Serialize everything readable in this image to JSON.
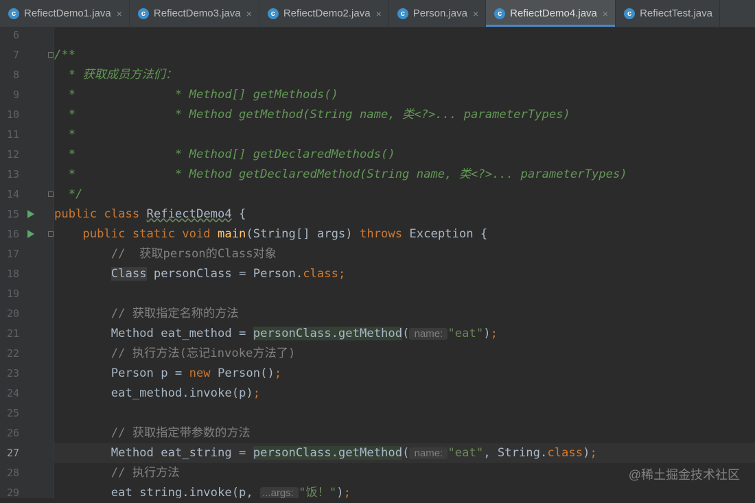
{
  "tabs": [
    {
      "label": "RefiectDemo1.java",
      "icon": "class-icon",
      "icon_glyph": "c",
      "closable": true,
      "active": false
    },
    {
      "label": "RefiectDemo3.java",
      "icon": "class-icon",
      "icon_glyph": "c",
      "closable": true,
      "active": false
    },
    {
      "label": "RefiectDemo2.java",
      "icon": "class-icon",
      "icon_glyph": "c",
      "closable": true,
      "active": false
    },
    {
      "label": "Person.java",
      "icon": "class-icon",
      "icon_glyph": "c",
      "closable": true,
      "active": false
    },
    {
      "label": "RefiectDemo4.java",
      "icon": "class-icon",
      "icon_glyph": "c",
      "closable": true,
      "active": true
    },
    {
      "label": "RefiectTest.java",
      "icon": "class-icon",
      "icon_glyph": "c",
      "closable": false,
      "active": false
    }
  ],
  "close_glyph": "×",
  "current_line": 27,
  "colors": {
    "keyword": "#cc7832",
    "comment": "#808080",
    "doc": "#629755",
    "string": "#6a8759",
    "method": "#ffc66d",
    "text": "#a9b7c6",
    "background": "#2b2b2b",
    "gutter": "#313335"
  },
  "lines": [
    {
      "n": "6",
      "tokens": []
    },
    {
      "n": "7",
      "fold": true,
      "tokens": [
        {
          "t": "/**",
          "c": "doc"
        }
      ]
    },
    {
      "n": "8",
      "tokens": [
        {
          "t": "  * 获取成员方法们：",
          "c": "doc"
        }
      ]
    },
    {
      "n": "9",
      "tokens": [
        {
          "t": "  *              * Method[] getMethods()",
          "c": "doc"
        }
      ]
    },
    {
      "n": "10",
      "tokens": [
        {
          "t": "  *              * Method getMethod(String name, ",
          "c": "doc"
        },
        {
          "t": "类",
          "c": "doc"
        },
        {
          "t": "<?>... parameterTypes)",
          "c": "doc"
        }
      ]
    },
    {
      "n": "11",
      "tokens": [
        {
          "t": "  *",
          "c": "doc"
        }
      ]
    },
    {
      "n": "12",
      "tokens": [
        {
          "t": "  *              * Method[] getDeclaredMethods()",
          "c": "doc"
        }
      ]
    },
    {
      "n": "13",
      "tokens": [
        {
          "t": "  *              * Method getDeclaredMethod(String name, ",
          "c": "doc"
        },
        {
          "t": "类",
          "c": "doc"
        },
        {
          "t": "<?>... parameterTypes)",
          "c": "doc"
        }
      ]
    },
    {
      "n": "14",
      "fold": true,
      "tokens": [
        {
          "t": "  */",
          "c": "doc"
        }
      ]
    },
    {
      "n": "15",
      "run": true,
      "tokens": [
        {
          "t": "public class ",
          "c": "kw"
        },
        {
          "t": "RefiectDemo4",
          "c": "cls-under"
        },
        {
          "t": " {",
          "c": ""
        }
      ]
    },
    {
      "n": "16",
      "run": true,
      "fold": true,
      "tokens": [
        {
          "t": "    public static void ",
          "c": "kw"
        },
        {
          "t": "main",
          "c": "fn"
        },
        {
          "t": "(String[] args) ",
          "c": ""
        },
        {
          "t": "throws ",
          "c": "kw"
        },
        {
          "t": "Exception {",
          "c": ""
        }
      ]
    },
    {
      "n": "17",
      "tokens": [
        {
          "t": "        //  获取person的Class对象",
          "c": "cm"
        }
      ]
    },
    {
      "n": "18",
      "tokens": [
        {
          "t": "        ",
          "c": ""
        },
        {
          "t": "Class",
          "c": "hl2"
        },
        {
          "t": " personClass = Person.",
          "c": ""
        },
        {
          "t": "class",
          "c": "kw"
        },
        {
          "t": ";",
          "c": "kw"
        }
      ]
    },
    {
      "n": "19",
      "tokens": []
    },
    {
      "n": "20",
      "tokens": [
        {
          "t": "        // 获取指定名称的方法",
          "c": "cm"
        }
      ]
    },
    {
      "n": "21",
      "tokens": [
        {
          "t": "        Method eat_method = ",
          "c": ""
        },
        {
          "t": "personClass.getMethod",
          "c": "hl"
        },
        {
          "t": "(",
          "c": ""
        },
        {
          "t": " name: ",
          "c": "hint"
        },
        {
          "t": "\"eat\"",
          "c": "str"
        },
        {
          "t": ")",
          "c": ""
        },
        {
          "t": ";",
          "c": "kw"
        }
      ]
    },
    {
      "n": "22",
      "tokens": [
        {
          "t": "        // 执行方法(忘记invoke方法了)",
          "c": "cm"
        }
      ]
    },
    {
      "n": "23",
      "tokens": [
        {
          "t": "        Person p = ",
          "c": ""
        },
        {
          "t": "new ",
          "c": "kw"
        },
        {
          "t": "Person()",
          "c": ""
        },
        {
          "t": ";",
          "c": "kw"
        }
      ]
    },
    {
      "n": "24",
      "tokens": [
        {
          "t": "        eat_method.invoke(p)",
          "c": ""
        },
        {
          "t": ";",
          "c": "kw"
        }
      ]
    },
    {
      "n": "25",
      "tokens": []
    },
    {
      "n": "26",
      "tokens": [
        {
          "t": "        // 获取指定带参数的方法",
          "c": "cm"
        }
      ]
    },
    {
      "n": "27",
      "tokens": [
        {
          "t": "        Method eat_string = ",
          "c": ""
        },
        {
          "t": "personClass.getMethod",
          "c": "hl"
        },
        {
          "t": "(",
          "c": ""
        },
        {
          "t": " name: ",
          "c": "hint"
        },
        {
          "t": "\"eat\"",
          "c": "str"
        },
        {
          "t": ", String.",
          "c": ""
        },
        {
          "t": "class",
          "c": "kw"
        },
        {
          "t": ")",
          "c": ""
        },
        {
          "t": ";",
          "c": "kw"
        }
      ]
    },
    {
      "n": "28",
      "tokens": [
        {
          "t": "        // 执行方法",
          "c": "cm"
        }
      ]
    },
    {
      "n": "29",
      "tokens": [
        {
          "t": "        eat_string.invoke(p, ",
          "c": ""
        },
        {
          "t": "...args: ",
          "c": "hint"
        },
        {
          "t": "\"饭！\"",
          "c": "str"
        },
        {
          "t": ")",
          "c": ""
        },
        {
          "t": ";",
          "c": "kw"
        }
      ]
    }
  ],
  "watermark": "@稀土掘金技术社区"
}
